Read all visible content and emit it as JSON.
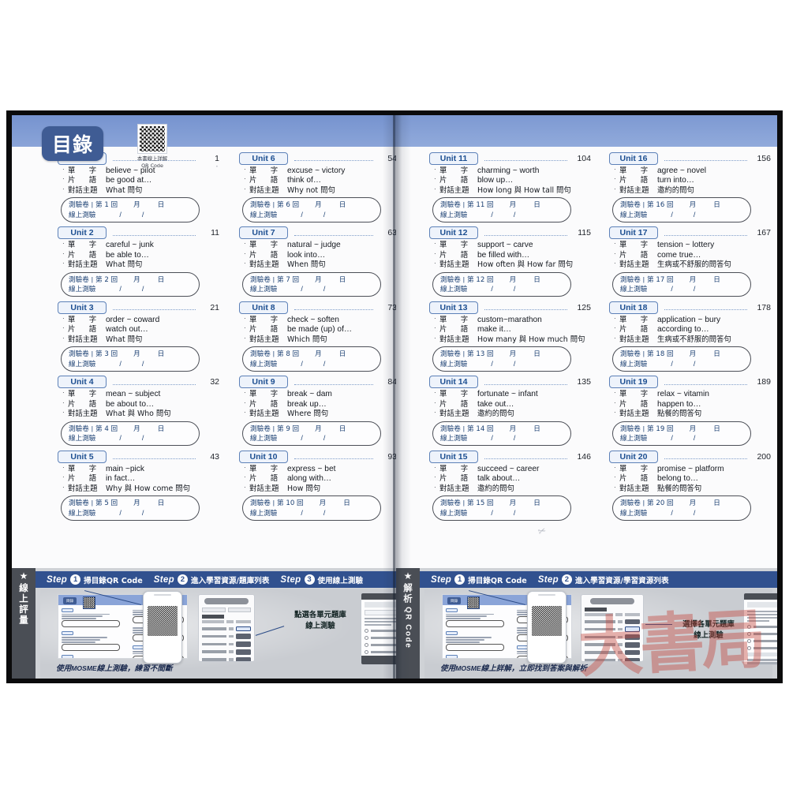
{
  "book": {
    "toc_title": "目錄",
    "header_qr_caption": "本書線上詳解\nQR Code",
    "header_qr_icon": "qr-code-icon"
  },
  "labels": {
    "vocab": "單　字",
    "phrase": "片　語",
    "dialogue": "對話主題",
    "test_paper": "測驗卷",
    "separator": "|",
    "round_prefix": "第",
    "round_suffix": "回",
    "month": "月",
    "day": "日",
    "online_test": "線上測驗",
    "slash": "/"
  },
  "columns": [
    {
      "id": "col1",
      "units": [
        {
          "unit": "Unit 1",
          "page": "1",
          "vocab": "believe ~ pilot",
          "phrase": "be good at…",
          "dialogue": "What 問句",
          "round": "1"
        },
        {
          "unit": "Unit 2",
          "page": "11",
          "vocab": "careful ~ junk",
          "phrase": "be able to…",
          "dialogue": "What 問句",
          "round": "2"
        },
        {
          "unit": "Unit 3",
          "page": "21",
          "vocab": "order ~ coward",
          "phrase": "watch out…",
          "dialogue": "What 問句",
          "round": "3"
        },
        {
          "unit": "Unit 4",
          "page": "32",
          "vocab": "mean ~ subject",
          "phrase": "be about to…",
          "dialogue": "What 與 Who 問句",
          "round": "4"
        },
        {
          "unit": "Unit 5",
          "page": "43",
          "vocab": "main ~pick",
          "phrase": "in fact…",
          "dialogue": "Why 與 How come 問句",
          "round": "5"
        }
      ]
    },
    {
      "id": "col2",
      "units": [
        {
          "unit": "Unit 6",
          "page": "54",
          "vocab": "excuse ~ victory",
          "phrase": "think of…",
          "dialogue": "Why not 問句",
          "round": "6"
        },
        {
          "unit": "Unit 7",
          "page": "63",
          "vocab": "natural ~ judge",
          "phrase": "look into…",
          "dialogue": "When 問句",
          "round": "7"
        },
        {
          "unit": "Unit 8",
          "page": "73",
          "vocab": "check ~ soften",
          "phrase": "be made (up) of…",
          "dialogue": "Which 問句",
          "round": "8"
        },
        {
          "unit": "Unit 9",
          "page": "84",
          "vocab": "break ~ dam",
          "phrase": "break up…",
          "dialogue": "Where 問句",
          "round": "9"
        },
        {
          "unit": "Unit 10",
          "page": "93",
          "vocab": "express ~ bet",
          "phrase": "along with…",
          "dialogue": "How 問句",
          "round": "10"
        }
      ]
    },
    {
      "id": "col3",
      "units": [
        {
          "unit": "Unit 11",
          "page": "104",
          "vocab": "charming ~ worth",
          "phrase": "blow up…",
          "dialogue": "How long 與 How tall 問句",
          "round": "11"
        },
        {
          "unit": "Unit 12",
          "page": "115",
          "vocab": "support ~ carve",
          "phrase": "be filled with…",
          "dialogue": "How often 與 How far 問句",
          "round": "12"
        },
        {
          "unit": "Unit 13",
          "page": "125",
          "vocab": "custom~marathon",
          "phrase": "make it…",
          "dialogue": "How many 與 How much 問句",
          "round": "13"
        },
        {
          "unit": "Unit 14",
          "page": "135",
          "vocab": "fortunate ~ infant",
          "phrase": "take out…",
          "dialogue": "邀約的問句",
          "round": "14"
        },
        {
          "unit": "Unit 15",
          "page": "146",
          "vocab": "succeed ~ career",
          "phrase": "talk about…",
          "dialogue": "邀約的問句",
          "round": "15"
        }
      ]
    },
    {
      "id": "col4",
      "units": [
        {
          "unit": "Unit 16",
          "page": "156",
          "vocab": "agree ~ novel",
          "phrase": "turn into…",
          "dialogue": "邀約的問句",
          "round": "16"
        },
        {
          "unit": "Unit 17",
          "page": "167",
          "vocab": "tension ~ lottery",
          "phrase": "come true…",
          "dialogue": "生病或不舒服的問答句",
          "round": "17"
        },
        {
          "unit": "Unit 18",
          "page": "178",
          "vocab": "application ~ bury",
          "phrase": "according to…",
          "dialogue": "生病或不舒服的問答句",
          "round": "18"
        },
        {
          "unit": "Unit 19",
          "page": "189",
          "vocab": "relax ~ vitamin",
          "phrase": "happen to…",
          "dialogue": "點餐的問答句",
          "round": "19"
        },
        {
          "unit": "Unit 20",
          "page": "200",
          "vocab": "promise ~ platform",
          "phrase": "belong to…",
          "dialogue": "點餐的問答句",
          "round": "20"
        }
      ]
    }
  ],
  "footer_left": {
    "side_star": "★",
    "side_label": "線上評量",
    "steps": [
      {
        "word": "Step",
        "num": "1",
        "text": "掃目錄QR Code"
      },
      {
        "word": "Step",
        "num": "2",
        "text": "進入學習資源/題庫列表"
      },
      {
        "word": "Step",
        "num": "3",
        "text": "使用線上測驗"
      }
    ],
    "note": "點選各單元題庫\n線上測驗",
    "caption_cjk_1": "使用",
    "caption_en": "MOSME",
    "caption_cjk_2": "線上測驗，練習不間斷",
    "mini_chip": "目錄"
  },
  "footer_right": {
    "side_star": "★",
    "side_label": "解析",
    "side_sub": "QR Code",
    "steps": [
      {
        "word": "Step",
        "num": "1",
        "text": "掃目錄QR Code"
      },
      {
        "word": "Step",
        "num": "2",
        "text": "進入學習資源/學習資源列表"
      }
    ],
    "note": "選擇各單元題庫\n線上測驗",
    "caption_cjk_1": "使用",
    "caption_en": "MOSME",
    "caption_cjk_2": "線上詳解，立即找到答案與解析",
    "mini_chip": "目錄"
  },
  "watermark": "大書局",
  "colors": {
    "band_blue": "#7e9bd4",
    "chip_navy": "#3f5c94",
    "unit_border": "#5d81b8",
    "unit_text": "#1d4f91",
    "step_bar": "#31518f",
    "footer_bg": "#cfd2d6",
    "side_dark": "#4a4e55",
    "watermark_red": "#c4463c"
  }
}
